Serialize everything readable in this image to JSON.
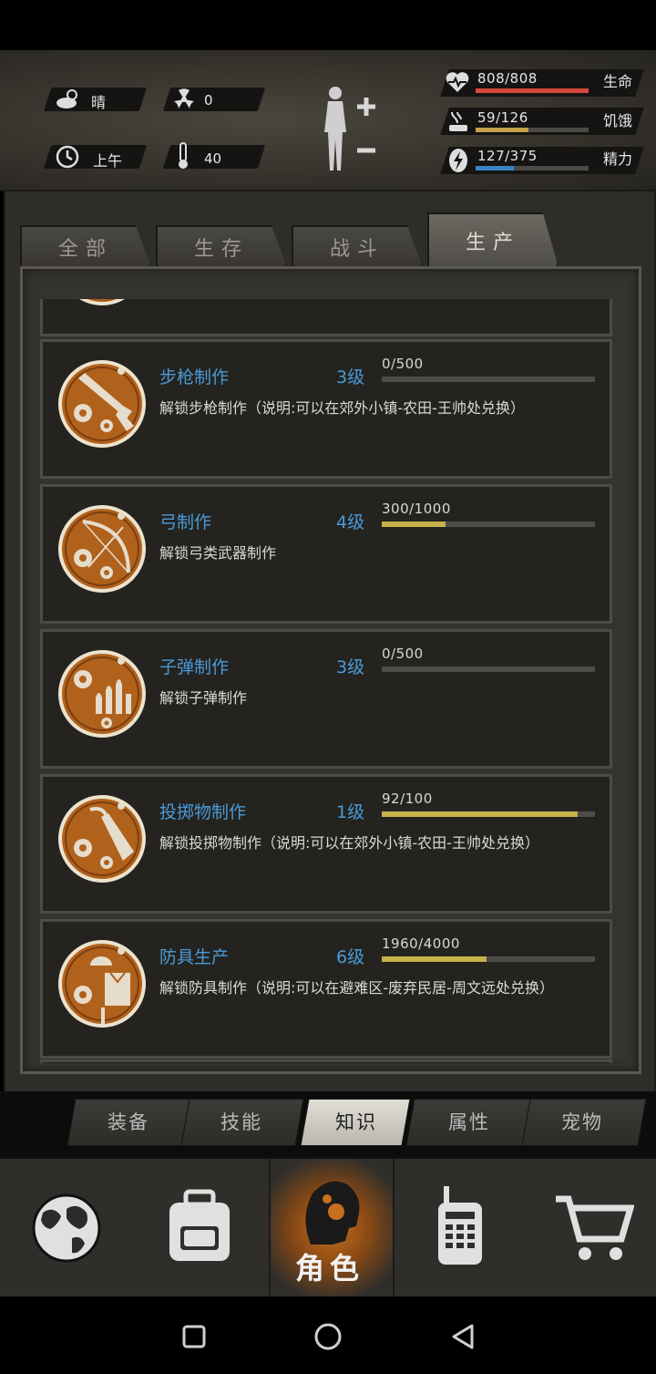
{
  "status": {
    "weather": "晴",
    "radiation": "0",
    "time_of_day": "上午",
    "temperature": "40",
    "stats": [
      {
        "value": "808/808",
        "label": "生命",
        "fraction": 1.0,
        "color": "#d8473c",
        "icon": "heart-pulse-icon"
      },
      {
        "value": "59/126",
        "label": "饥饿",
        "fraction": 0.468,
        "color": "#c6a14a",
        "icon": "hunger-icon"
      },
      {
        "value": "127/375",
        "label": "精力",
        "fraction": 0.339,
        "color": "#3d82c4",
        "icon": "energy-icon"
      }
    ]
  },
  "category_tabs": [
    {
      "label": "全部",
      "active": false
    },
    {
      "label": "生存",
      "active": false
    },
    {
      "label": "战斗",
      "active": false
    },
    {
      "label": "生产",
      "active": true
    }
  ],
  "skills": [
    {
      "title": "步枪制作",
      "level": "3级",
      "progress": "0/500",
      "fraction": 0.0,
      "desc": "解锁步枪制作（说明:可以在郊外小镇-农田-王帅处兑换）",
      "icon": "rifle-craft-icon"
    },
    {
      "title": "弓制作",
      "level": "4级",
      "progress": "300/1000",
      "fraction": 0.3,
      "desc": "解锁弓类武器制作",
      "icon": "bow-craft-icon"
    },
    {
      "title": "子弹制作",
      "level": "3级",
      "progress": "0/500",
      "fraction": 0.0,
      "desc": "解锁子弹制作",
      "icon": "bullet-craft-icon"
    },
    {
      "title": "投掷物制作",
      "level": "1级",
      "progress": "92/100",
      "fraction": 0.92,
      "desc": "解锁投掷物制作（说明:可以在郊外小镇-农田-王帅处兑换）",
      "icon": "throwable-craft-icon"
    },
    {
      "title": "防具生产",
      "level": "6级",
      "progress": "1960/4000",
      "fraction": 0.49,
      "desc": "解锁防具制作（说明:可以在避难区-废弃民居-周文远处兑换）",
      "icon": "armor-craft-icon"
    }
  ],
  "sub_tabs": [
    {
      "label": "装备",
      "active": false
    },
    {
      "label": "技能",
      "active": false
    },
    {
      "label": "知识",
      "active": true
    },
    {
      "label": "属性",
      "active": false
    },
    {
      "label": "宠物",
      "active": false
    }
  ],
  "bottom_nav": {
    "role_label": "角色",
    "items": [
      "globe-icon",
      "backpack-icon",
      "character-head-icon",
      "walkie-talkie-icon",
      "shopping-cart-icon"
    ]
  },
  "colors": {
    "skill_title": "#4a9ad8",
    "progress_fill": "#c6b14a",
    "active_nav": "#c6701e"
  }
}
